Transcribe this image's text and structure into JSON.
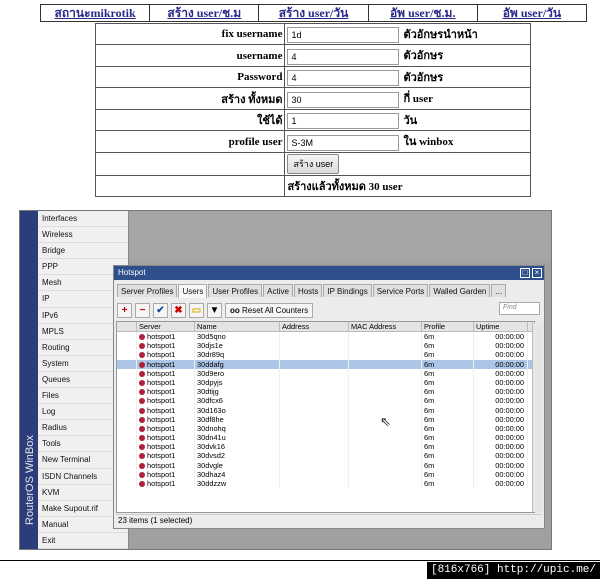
{
  "nav": [
    "สถานะmikrotik",
    "สร้าง user/ช.ม",
    "สร้าง user/วัน",
    "อัพ user/ช.ม.",
    "อัพ user/วัน"
  ],
  "form": {
    "fix_username": {
      "label": "fix username",
      "value": "1d",
      "suffix": "ตัวอักษรนำหน้า"
    },
    "username": {
      "label": "username",
      "value": "4",
      "suffix": "ตัวอักษร"
    },
    "password": {
      "label": "Password",
      "value": "4",
      "suffix": "ตัวอักษร"
    },
    "create_all": {
      "label": "สร้าง ทั้งหมด",
      "value": "30",
      "suffix": "กี่ user"
    },
    "usable": {
      "label": "ใช้ได้",
      "value": "1",
      "suffix": "วัน"
    },
    "profile_user": {
      "label": "profile user",
      "value": "S-3M",
      "suffix": "ใน winbox"
    },
    "create_button": "สร้าง user",
    "result": "สร้างแล้วทั้งหมด 30 user"
  },
  "winbox": {
    "vertical_title": "RouterOS WinBox",
    "menu": [
      {
        "label": "Interfaces",
        "arrow": false
      },
      {
        "label": "Wireless",
        "arrow": false
      },
      {
        "label": "Bridge",
        "arrow": false
      },
      {
        "label": "PPP",
        "arrow": false
      },
      {
        "label": "Mesh",
        "arrow": false
      },
      {
        "label": "IP",
        "arrow": true
      },
      {
        "label": "IPv6",
        "arrow": true
      },
      {
        "label": "MPLS",
        "arrow": true
      },
      {
        "label": "Routing",
        "arrow": true
      },
      {
        "label": "System",
        "arrow": true
      },
      {
        "label": "Queues",
        "arrow": false
      },
      {
        "label": "Files",
        "arrow": false
      },
      {
        "label": "Log",
        "arrow": false
      },
      {
        "label": "Radius",
        "arrow": false
      },
      {
        "label": "Tools",
        "arrow": true
      },
      {
        "label": "New Terminal",
        "arrow": false
      },
      {
        "label": "ISDN Channels",
        "arrow": false
      },
      {
        "label": "KVM",
        "arrow": false
      },
      {
        "label": "Make Supout.rif",
        "arrow": false
      },
      {
        "label": "Manual",
        "arrow": false
      },
      {
        "label": "Exit",
        "arrow": false
      }
    ],
    "hotspot": {
      "title": "Hotspot",
      "tabs": [
        "Server Profiles",
        "Users",
        "User Profiles",
        "Active",
        "Hosts",
        "IP Bindings",
        "Service Ports",
        "Walled Garden",
        "..."
      ],
      "active_tab": "Users",
      "reset_counters": "Reset All Counters",
      "reset_icon_text": "oo",
      "find_placeholder": "Find",
      "columns": [
        "Server",
        "Name",
        "Address",
        "MAC Address",
        "Profile",
        "Uptime"
      ],
      "rows": [
        {
          "server": "hotspot1",
          "name": "30d5qno",
          "profile": "6m",
          "uptime": "00:00:00"
        },
        {
          "server": "hotspot1",
          "name": "30djs1e",
          "profile": "6m",
          "uptime": "00:00:00"
        },
        {
          "server": "hotspot1",
          "name": "30dr89q",
          "profile": "6m",
          "uptime": "00:00:00"
        },
        {
          "server": "hotspot1",
          "name": "30ddafg",
          "profile": "6m",
          "uptime": "00:00:00",
          "selected": true
        },
        {
          "server": "hotspot1",
          "name": "30d9ero",
          "profile": "6m",
          "uptime": "00:00:00"
        },
        {
          "server": "hotspot1",
          "name": "30dpyjs",
          "profile": "6m",
          "uptime": "00:00:00"
        },
        {
          "server": "hotspot1",
          "name": "30dtijg",
          "profile": "6m",
          "uptime": "00:00:00"
        },
        {
          "server": "hotspot1",
          "name": "30dfcx6",
          "profile": "6m",
          "uptime": "00:00:00"
        },
        {
          "server": "hotspot1",
          "name": "30d163o",
          "profile": "6m",
          "uptime": "00:00:00"
        },
        {
          "server": "hotspot1",
          "name": "30df8he",
          "profile": "6m",
          "uptime": "00:00:00"
        },
        {
          "server": "hotspot1",
          "name": "30dnohq",
          "profile": "6m",
          "uptime": "00:00:00"
        },
        {
          "server": "hotspot1",
          "name": "30dn41u",
          "profile": "6m",
          "uptime": "00:00:00"
        },
        {
          "server": "hotspot1",
          "name": "30dvk16",
          "profile": "6m",
          "uptime": "00:00:00"
        },
        {
          "server": "hotspot1",
          "name": "30dvsd2",
          "profile": "6m",
          "uptime": "00:00:00"
        },
        {
          "server": "hotspot1",
          "name": "30dvgle",
          "profile": "6m",
          "uptime": "00:00:00"
        },
        {
          "server": "hotspot1",
          "name": "30dhaz4",
          "profile": "6m",
          "uptime": "00:00:00"
        },
        {
          "server": "hotspot1",
          "name": "30ddzzw",
          "profile": "6m",
          "uptime": "00:00:00"
        }
      ],
      "status": "23 items (1 selected)"
    }
  },
  "footer": "[816x766] http://upic.me/"
}
